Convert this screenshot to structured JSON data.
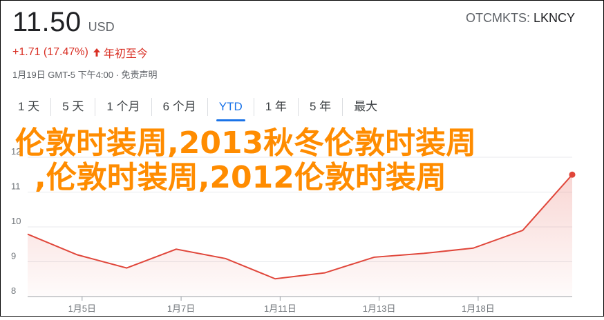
{
  "header": {
    "price": "11.50",
    "currency": "USD",
    "exchange": "OTCMKTS",
    "symbol": "LKNCY",
    "change_text": "+1.71 (17.47%)",
    "period_label": "年初至今",
    "timestamp": "1月19日 GMT-5 下午4:00 · 免责声明"
  },
  "tabs": [
    {
      "label": "1 天"
    },
    {
      "label": "5 天"
    },
    {
      "label": "1 个月"
    },
    {
      "label": "6 个月"
    },
    {
      "label": "YTD"
    },
    {
      "label": "1 年"
    },
    {
      "label": "5 年"
    },
    {
      "label": "最大"
    }
  ],
  "overlay": {
    "line1": "伦敦时装周,2013秋冬伦敦时装周",
    "line2": ",伦敦时装周,2012伦敦时装周"
  },
  "colors": {
    "line": "#e0463a",
    "accent": "#1a73e8",
    "negative_positive": "#d93025",
    "overlay_text": "#ff8c00"
  },
  "chart_data": {
    "type": "area",
    "x": [
      "2021-01-04",
      "2021-01-05",
      "2021-01-06",
      "2021-01-07",
      "2021-01-08",
      "2021-01-11",
      "2021-01-12",
      "2021-01-13",
      "2021-01-14",
      "2021-01-15",
      "2021-01-19"
    ],
    "y": [
      9.79,
      9.2,
      8.82,
      9.36,
      9.09,
      8.51,
      8.68,
      9.13,
      9.24,
      9.39,
      9.9,
      11.5
    ],
    "series": [
      {
        "values": [
          9.79,
          9.2,
          8.82,
          9.36,
          9.09,
          8.51,
          8.68,
          9.13,
          9.24,
          9.39,
          9.9,
          11.5
        ]
      }
    ],
    "x_tick_labels": [
      "1月5日",
      "1月7日",
      "1月11日",
      "1月13日",
      "1月18日"
    ],
    "y_tick_labels": [
      "8",
      "9",
      "10",
      "11",
      "12"
    ],
    "ylim": [
      8,
      12
    ],
    "grid": true
  }
}
